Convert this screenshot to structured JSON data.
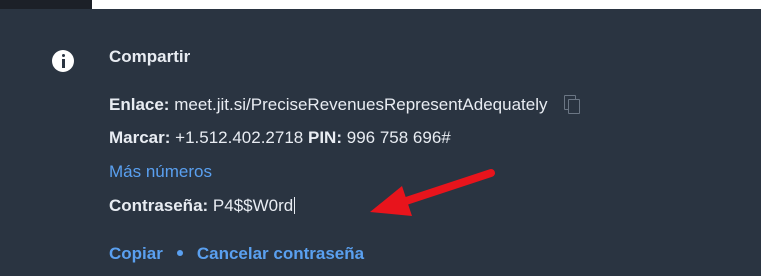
{
  "share": {
    "title": "Compartir",
    "link_label": "Enlace:",
    "link_value": "meet.jit.si/PreciseRevenuesRepresentAdequately",
    "dial_label": "Marcar:",
    "dial_value": "+1.512.402.2718",
    "pin_label": "PIN:",
    "pin_value": "996 758 696#",
    "more_numbers": "Más números",
    "password_label": "Contraseña:",
    "password_value": "P4$$W0rd",
    "copy_action": "Copiar",
    "cancel_password_action": "Cancelar contraseña"
  },
  "icons": {
    "info": "info-icon",
    "copy": "copy-icon",
    "annotation": "red-arrow"
  },
  "colors": {
    "panel_bg": "#2a3441",
    "text": "#e8ecf2",
    "link": "#5aa0f0",
    "arrow": "#e8141c"
  }
}
